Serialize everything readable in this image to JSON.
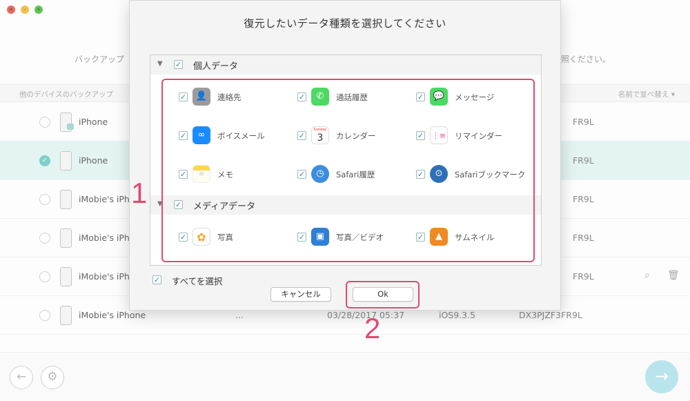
{
  "background": {
    "prompt_left": "バックアップ",
    "prompt_right": "照ください。",
    "header_left": "他のデバイスのバックアップ",
    "header_right": "名前で並べ替え ▾",
    "rows": [
      {
        "name": "iPhone",
        "serial_fragment": "FR9L",
        "selected": false
      },
      {
        "name": "iPhone",
        "serial_fragment": "FR9L",
        "selected": true
      },
      {
        "name": "iMobie's iPho",
        "serial_fragment": "FR9L",
        "selected": false
      },
      {
        "name": "iMobie's iPho",
        "serial_fragment": "FR9L",
        "selected": false
      },
      {
        "name": "iMobie's iPho",
        "serial_fragment": "FR9L",
        "selected": false
      },
      {
        "name": "iMobie's iPhone",
        "dots": "...",
        "date": "03/28/2017 05:37",
        "ios": "iOS9.3.5",
        "serial": "DX3PJZF3FR9L",
        "selected": false
      }
    ]
  },
  "dialog": {
    "title": "復元したいデータ種類を選択してください",
    "categories": [
      {
        "label": "個人データ",
        "items": [
          {
            "label": "連絡先",
            "icon": "contacts-icon",
            "color": "#8e8e93"
          },
          {
            "label": "通話履歴",
            "icon": "phone-icon",
            "color": "#4cd964"
          },
          {
            "label": "メッセージ",
            "icon": "messages-icon",
            "color": "#4cd964"
          },
          {
            "label": "ボイスメール",
            "icon": "voicemail-icon",
            "color": "#1a8cff"
          },
          {
            "label": "カレンダー",
            "icon": "calendar-icon",
            "color": "#ffffff"
          },
          {
            "label": "リマインダー",
            "icon": "reminders-icon",
            "color": "#ffffff"
          },
          {
            "label": "メモ",
            "icon": "notes-icon",
            "color": "#ffd64d"
          },
          {
            "label": "Safari履歴",
            "icon": "safari-history-icon",
            "color": "#3d8de0"
          },
          {
            "label": "Safariブックマーク",
            "icon": "safari-bookmark-icon",
            "color": "#2f6fb8"
          }
        ]
      },
      {
        "label": "メディアデータ",
        "items": [
          {
            "label": "写真",
            "icon": "photos-icon",
            "color": "#ffffff"
          },
          {
            "label": "写真／ビデオ",
            "icon": "photo-video-icon",
            "color": "#2f7fd6"
          },
          {
            "label": "サムネイル",
            "icon": "thumbnail-icon",
            "color": "#f08a24"
          }
        ]
      }
    ],
    "calendar_day": "3",
    "calendar_weekday": "Sunday",
    "select_all": "すべてを選択",
    "cancel": "キャンセル",
    "ok": "Ok"
  },
  "annotations": {
    "one": "1",
    "two": "2",
    "color": "#e04a6f"
  },
  "colors": {
    "check": "#3a8b95",
    "selected_row": "#e3f4f3",
    "next_button": "#b9e4ec"
  }
}
